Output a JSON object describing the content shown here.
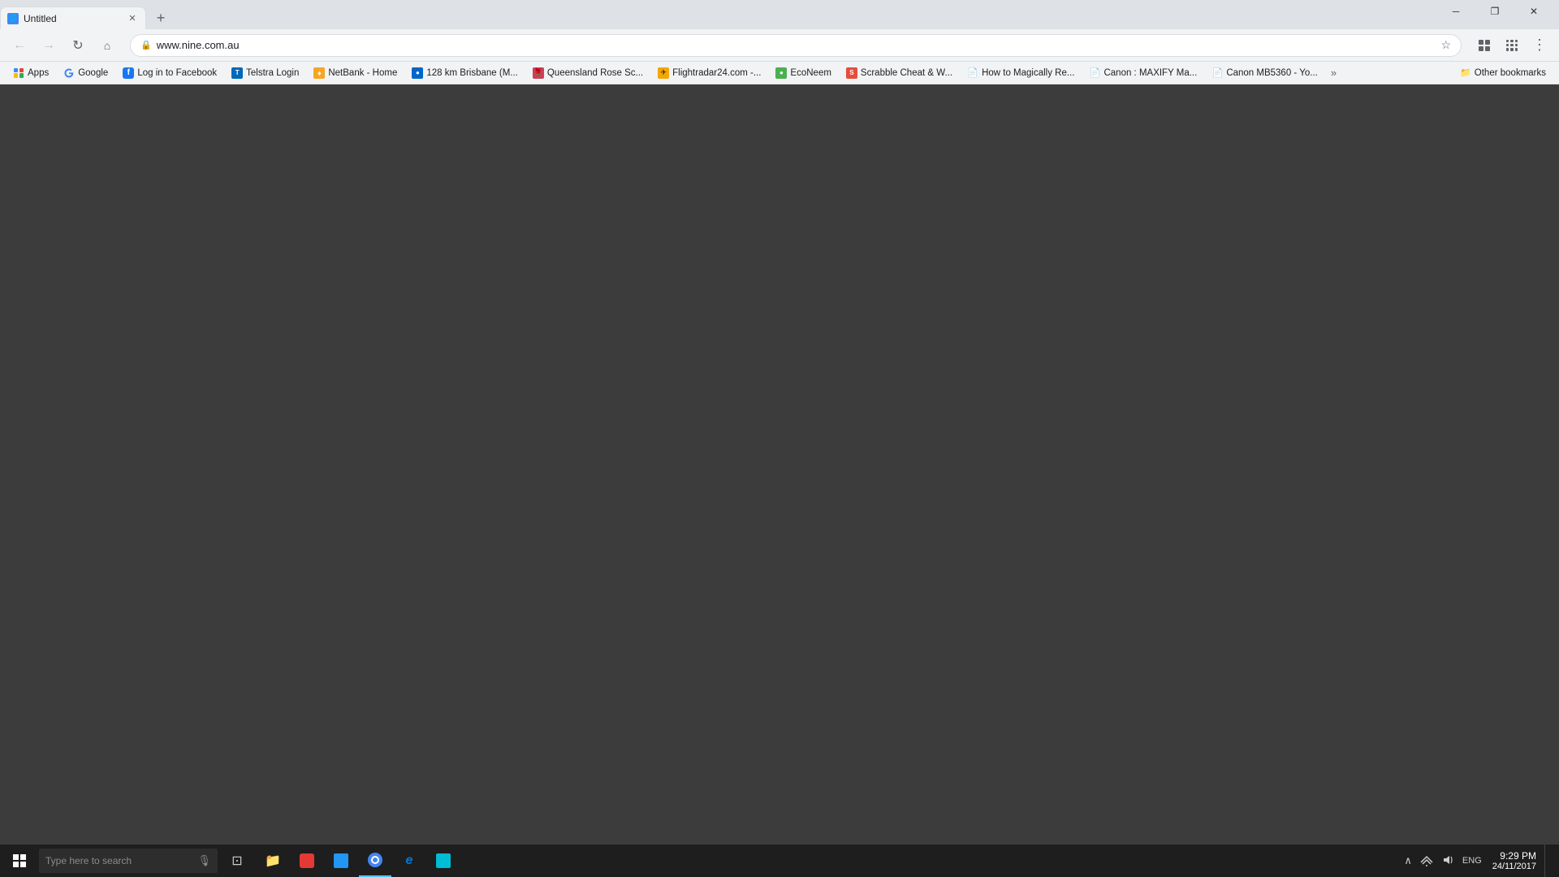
{
  "browser": {
    "tab": {
      "title": "Untitled",
      "favicon": "🌐"
    },
    "address_bar": {
      "url": "www.nine.com.au",
      "lock_icon": "🔒"
    },
    "bookmarks": [
      {
        "id": "apps",
        "label": "Apps",
        "icon": "grid",
        "has_icon": true
      },
      {
        "id": "google",
        "label": "Google",
        "icon": "G",
        "color": "google"
      },
      {
        "id": "facebook",
        "label": "Log in to Facebook",
        "icon": "f",
        "color": "fb"
      },
      {
        "id": "telstra",
        "label": "Telstra Login",
        "icon": "T",
        "color": "telstra"
      },
      {
        "id": "netbank",
        "label": "NetBank - Home",
        "icon": "♦",
        "color": "netbank"
      },
      {
        "id": "bom",
        "label": "128 km Brisbane (M...",
        "icon": "●",
        "color": "bom"
      },
      {
        "id": "rose",
        "label": "Queensland Rose Sc...",
        "icon": "🌹",
        "color": "rose"
      },
      {
        "id": "flightradar",
        "label": "Flightradar24.com -...",
        "icon": "✈",
        "color": "flightradar"
      },
      {
        "id": "econeem",
        "label": "EcoNeem",
        "icon": "●",
        "color": "econeem"
      },
      {
        "id": "scrabble",
        "label": "Scrabble Cheat & W...",
        "icon": "S",
        "color": "scrabble"
      },
      {
        "id": "howto",
        "label": "How to Magically Re...",
        "icon": "📄",
        "color": "doc"
      },
      {
        "id": "canon1",
        "label": "Canon : MAXIFY Ma...",
        "icon": "📄",
        "color": "doc"
      },
      {
        "id": "canon2",
        "label": "Canon MB5360 - Yo...",
        "icon": "📄",
        "color": "doc"
      }
    ],
    "more_label": "»",
    "other_bookmarks_label": "Other bookmarks"
  },
  "taskbar": {
    "search_placeholder": "Type here to search",
    "tasks": [
      {
        "id": "task-view",
        "icon": "⊡"
      },
      {
        "id": "file-explorer",
        "icon": "📁"
      },
      {
        "id": "task3",
        "icon": "🔴"
      },
      {
        "id": "task4",
        "icon": "🎨"
      },
      {
        "id": "chrome",
        "icon": "🌐"
      },
      {
        "id": "ie",
        "icon": "e"
      },
      {
        "id": "task7",
        "icon": "🟦"
      }
    ],
    "tray": {
      "chevron": "∧",
      "wifi": "📶",
      "volume": "🔊",
      "language": "ENG",
      "time": "9:29 PM",
      "date": "24/11/2017"
    }
  },
  "window_controls": {
    "minimize": "─",
    "restore": "❐",
    "close": "✕"
  }
}
